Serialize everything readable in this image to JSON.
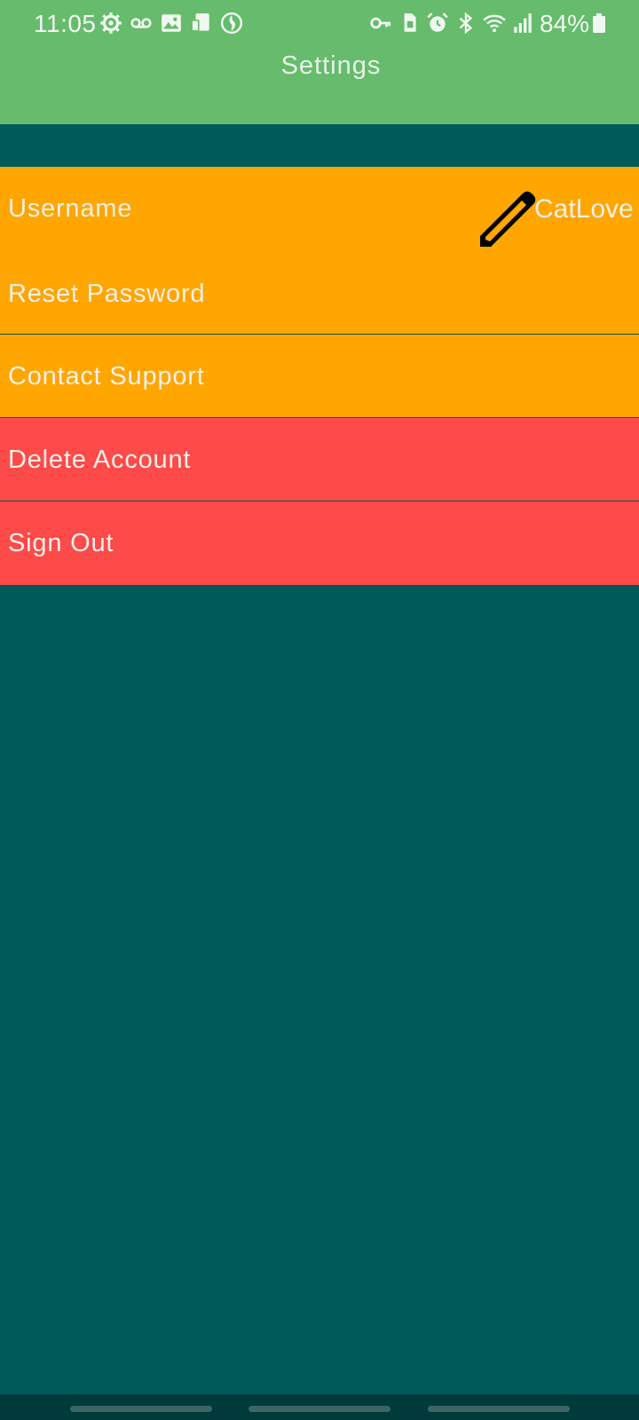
{
  "status_bar": {
    "time": "11:05",
    "battery": "84%",
    "left_icons": [
      "gear-icon",
      "voicemail-icon",
      "image-icon",
      "tablet-icon",
      "globe-icon"
    ],
    "right_icons": [
      "key-icon",
      "sim-icon",
      "alarm-icon",
      "bluetooth-icon",
      "wifi-icon",
      "signal-icon"
    ]
  },
  "header": {
    "title": "Settings"
  },
  "settings": {
    "username_label": "Username",
    "username_value": "CatLove",
    "reset_password_label": "Reset Password",
    "contact_support_label": "Contact Support",
    "delete_account_label": "Delete Account",
    "sign_out_label": "Sign Out"
  },
  "colors": {
    "header": "#66bc6c",
    "background": "#015a5a",
    "orange": "#ffa601",
    "red": "#ff4a4a"
  }
}
